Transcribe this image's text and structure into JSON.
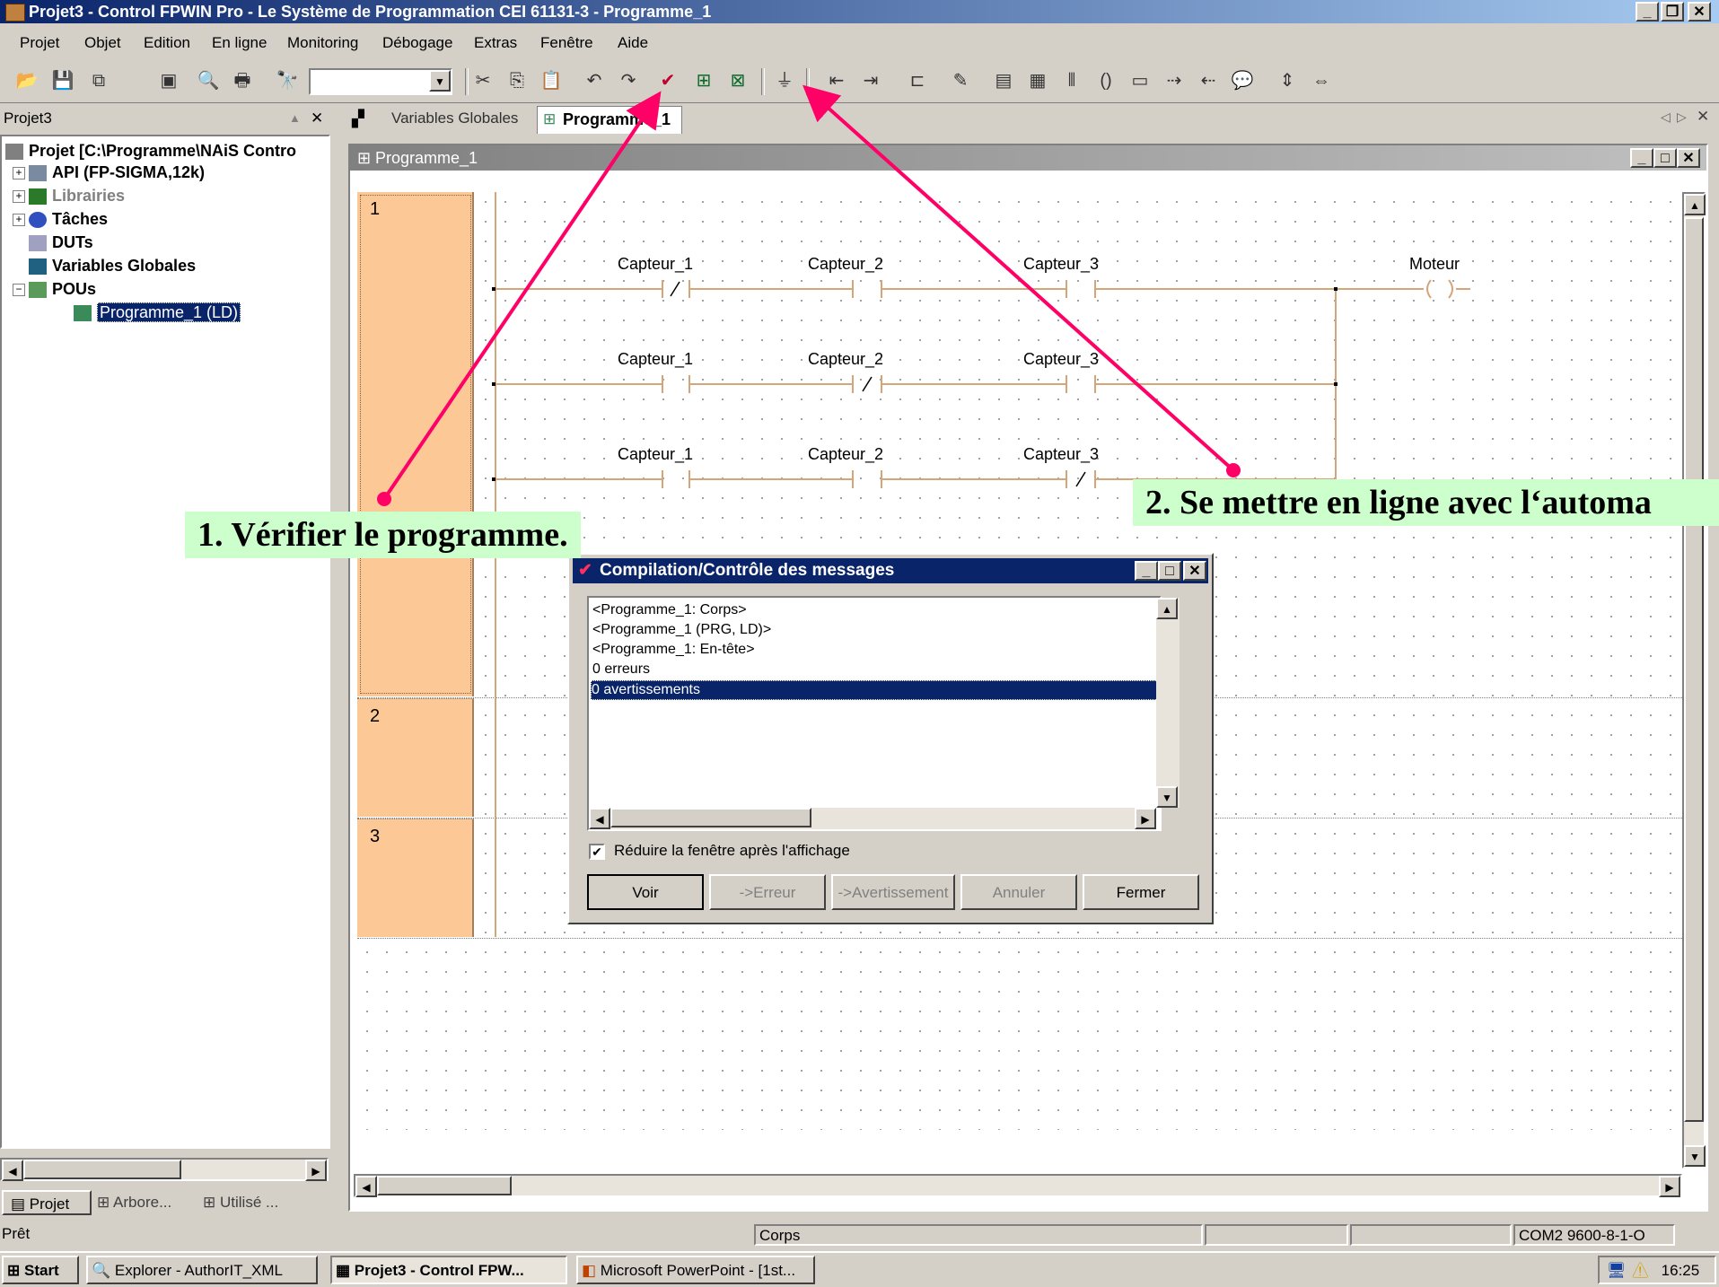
{
  "window": {
    "title": "Projet3 - Control FPWIN Pro - Le Système de Programmation CEI 61131-3 - Programme_1"
  },
  "menu": [
    "Projet",
    "Objet",
    "Edition",
    "En ligne",
    "Monitoring",
    "Débogage",
    "Extras",
    "Fenêtre",
    "Aide"
  ],
  "left_pane": {
    "title": "Projet3",
    "tree": [
      {
        "label": "Projet [C:\\Programme\\NAiS Contro",
        "icon": "project-icon"
      },
      {
        "label": "API (FP-SIGMA,12k)",
        "icon": "plc-icon"
      },
      {
        "label": "Librairies",
        "icon": "library-icon"
      },
      {
        "label": "Tâches",
        "icon": "tasks-icon"
      },
      {
        "label": "DUTs",
        "icon": "dut-icon"
      },
      {
        "label": "Variables Globales",
        "icon": "global-vars-icon"
      },
      {
        "label": "POUs",
        "icon": "pou-icon"
      },
      {
        "label": "Programme_1 (LD)",
        "icon": "program-icon"
      }
    ],
    "tabs": [
      "Projet",
      "Arbore...",
      "Utilisé ..."
    ]
  },
  "doc_tabs": [
    "Variables Globales",
    "Programme_1"
  ],
  "editor": {
    "title": "Programme_1",
    "rungs": [
      "1",
      "2",
      "3"
    ],
    "network": {
      "row1": [
        "Capteur_1",
        "Capteur_2",
        "Capteur_3"
      ],
      "row2": [
        "Capteur_1",
        "Capteur_2",
        "Capteur_3"
      ],
      "row3": [
        "Capteur_1",
        "Capteur_2",
        "Capteur_3"
      ],
      "coil": "Moteur"
    }
  },
  "dialog": {
    "title": "Compilation/Contrôle des messages",
    "messages": [
      "<Programme_1: Corps>",
      "<Programme_1 (PRG, LD)>",
      "<Programme_1: En-tête>",
      "0 erreurs",
      "0 avertissements"
    ],
    "selected_index": 4,
    "checkbox_label": "Réduire la fenêtre après l'affichage",
    "checkbox_checked": true,
    "buttons": [
      "Voir",
      "->Erreur",
      "->Avertissement",
      "Annuler",
      "Fermer"
    ]
  },
  "callouts": {
    "one": "1. Vérifier le programme.",
    "two": "2. Se mettre en ligne avec l‘automa"
  },
  "status": {
    "ready": "Prêt",
    "section": "Corps",
    "port": "COM2 9600-8-1-O"
  },
  "taskbar": {
    "start": "Start",
    "tasks": [
      "Explorer - AuthorIT_XML",
      "Projet3 - Control FPW...",
      "Microsoft PowerPoint - [1st..."
    ],
    "clock": "16:25"
  },
  "colors": {
    "rung_bg": "#fcc996",
    "arrow": "#ff0066",
    "callout_bg": "#ccffcc",
    "title_blue": "#0a246a"
  }
}
